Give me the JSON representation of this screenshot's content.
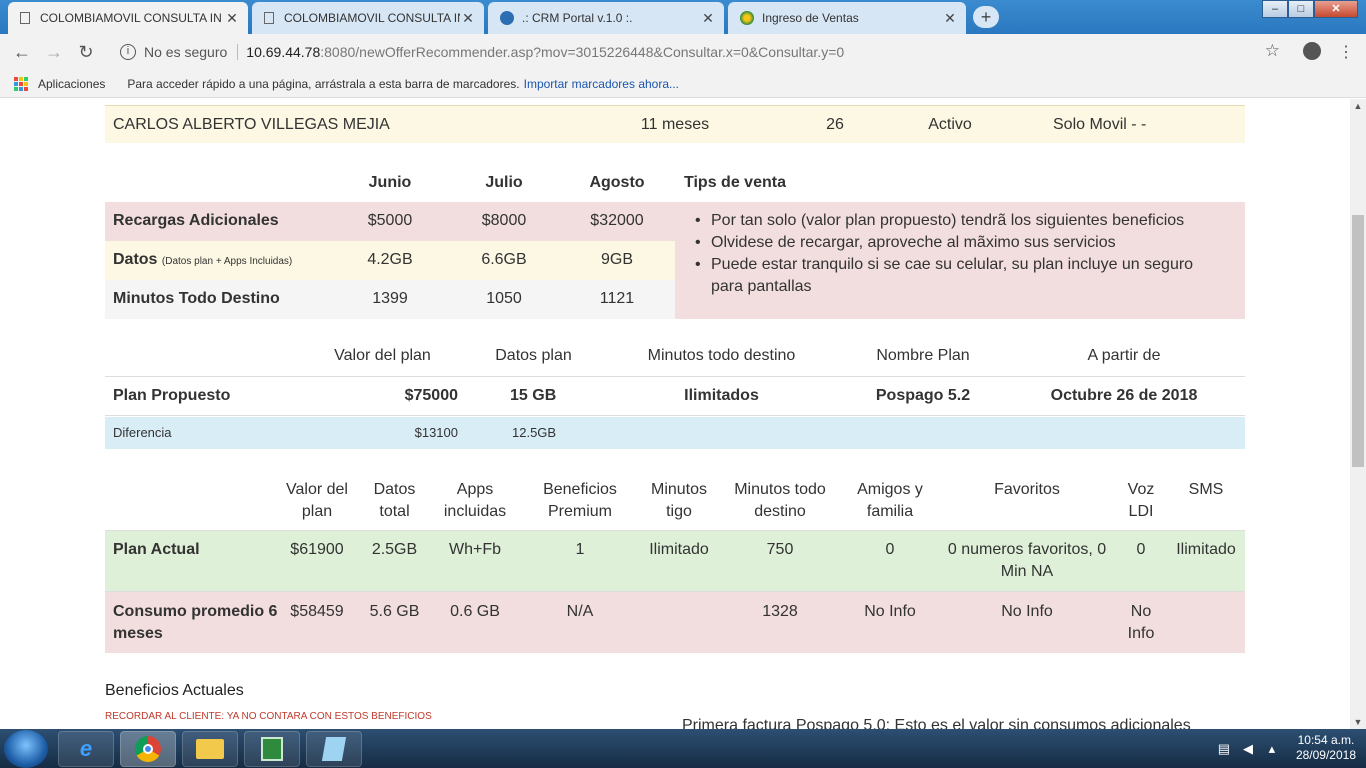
{
  "browser": {
    "tabs": [
      {
        "label": "COLOMBIAMOVIL CONSULTA IN",
        "active": true,
        "icon": "document-icon"
      },
      {
        "label": "COLOMBIAMOVIL CONSULTA IN",
        "active": false,
        "icon": "document-icon"
      },
      {
        "label": ".: CRM Portal v.1.0 :.",
        "active": false,
        "icon": "crm-icon"
      },
      {
        "label": "Ingreso de Ventas",
        "active": false,
        "icon": "globe-icon"
      }
    ],
    "new_tab": "+",
    "window_controls": {
      "minimize": "–",
      "maximize": "□",
      "close": "✕"
    },
    "security_label": "No es seguro",
    "url_host": "10.69.44.78",
    "url_rest": ":8080/newOfferRecommender.asp?mov=3015226448&Consultar.x=0&Consultar.y=0",
    "apps_label": "Aplicaciones",
    "bookmarks_hint": "Para acceder rápido a una página, arrástrala a esta barra de marcadores.",
    "bookmarks_import": "Importar marcadores ahora..."
  },
  "customer": {
    "name": "CARLOS ALBERTO VILLEGAS MEJIA",
    "tenure": "11 meses",
    "number": "26",
    "status": "Activo",
    "plan_type": "Solo Movil - -"
  },
  "history": {
    "months": [
      "Junio",
      "Julio",
      "Agosto"
    ],
    "tips_title": "Tips de venta",
    "rows": [
      {
        "label": "Recargas Adicionales",
        "note": "",
        "values": [
          "$5000",
          "$8000",
          "$32000"
        ]
      },
      {
        "label": "Datos",
        "note": "(Datos plan + Apps Incluidas)",
        "values": [
          "4.2GB",
          "6.6GB",
          "9GB"
        ]
      },
      {
        "label": "Minutos Todo Destino",
        "note": "",
        "values": [
          "1399",
          "1050",
          "1121"
        ]
      }
    ],
    "tips": [
      "Por tan solo (valor plan propuesto) tendrã los siguientes beneficios",
      "Olvidese de recargar, aproveche al mãximo sus servicios",
      "Puede estar tranquilo si se cae su celular, su plan incluye un seguro para pantallas"
    ]
  },
  "proposed": {
    "headers": [
      "Valor del plan",
      "Datos plan",
      "Minutos todo destino",
      "Nombre Plan",
      "A partir de"
    ],
    "label": "Plan Propuesto",
    "values": [
      "$75000",
      "15 GB",
      "Ilimitados",
      "Pospago 5.2",
      "Octubre 26 de 2018"
    ],
    "diff_label": "Diferencia",
    "diff_values": [
      "$13100",
      "12.5GB"
    ]
  },
  "current": {
    "headers": [
      "Valor del plan",
      "Datos total",
      "Apps incluidas",
      "Beneficios Premium",
      "Minutos tigo",
      "Minutos todo destino",
      "Amigos y familia",
      "Favoritos",
      "Voz LDI",
      "SMS"
    ],
    "plan_label": "Plan Actual",
    "plan_values": [
      "$61900",
      "2.5GB",
      "Wh+Fb",
      "1",
      "Ilimitado",
      "750",
      "0",
      "0 numeros favoritos, 0 Min NA",
      "0",
      "Ilimitado"
    ],
    "consumption_label": "Consumo promedio 6 meses",
    "consumption_values": [
      "$58459",
      "5.6 GB",
      "0.6 GB",
      "N/A",
      "",
      "1328",
      "No Info",
      "No Info",
      "No Info",
      ""
    ]
  },
  "benefits": {
    "title": "Beneficios Actuales",
    "note": "RECORDAR AL CLIENTE: YA NO CONTARA CON ESTOS BENEFICIOS",
    "factura": "Primera factura Pospago 5.0: Esto es el valor sin consumos adicionales"
  },
  "taskbar": {
    "time": "10:54 a.m.",
    "date": "28/09/2018"
  },
  "colors": {
    "tab_strip": "#2a78bf",
    "customer_bg": "#fcf8e3",
    "pink_bg": "#f2dede",
    "blue_bg": "#d9edf7",
    "green_bg": "#dff0d8",
    "note_red": "#c0392b"
  }
}
